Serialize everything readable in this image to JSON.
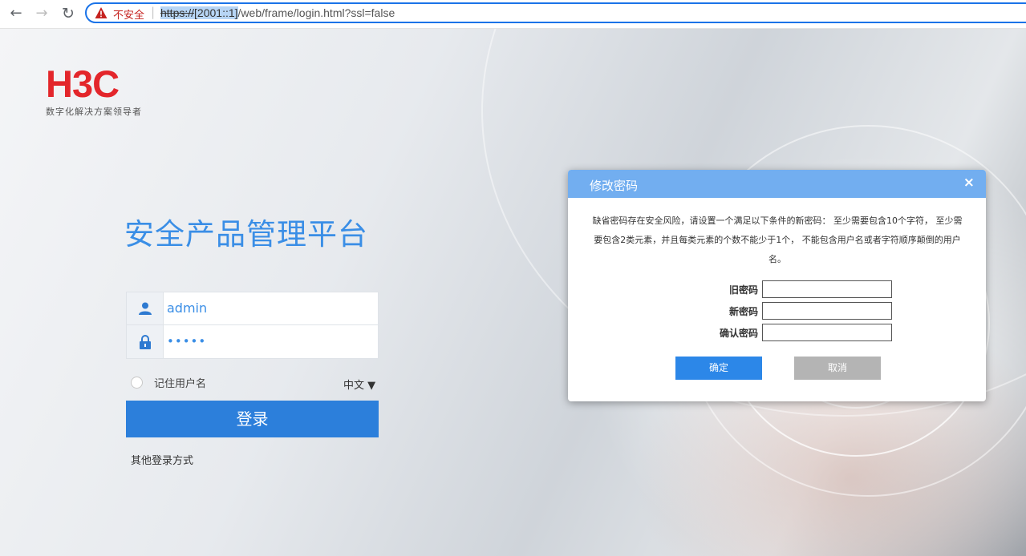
{
  "browser": {
    "security_warning": "不安全",
    "url_protocol": "https://",
    "url_host": "[2001::1]",
    "url_path": "/web/frame/login.html?ssl=false"
  },
  "logo": {
    "brand": "H3C",
    "slogan": "数字化解决方案领导者",
    "color": "#e3262b"
  },
  "login": {
    "title": "安全产品管理平台",
    "username": "admin",
    "password_mask": "•••••",
    "remember_label": "记住用户名",
    "language": "中文 ▼",
    "login_button": "登录",
    "other_login": "其他登录方式",
    "accent_color": "#2c7fdb"
  },
  "dialog": {
    "title": "修改密码",
    "close": "×",
    "message": "缺省密码存在安全风险，请设置一个满足以下条件的新密码： 至少需要包含10个字符， 至少需要包含2类元素，并且每类元素的个数不能少于1个， 不能包含用户名或者字符顺序颠倒的用户名。",
    "old_password_label": "旧密码",
    "new_password_label": "新密码",
    "confirm_password_label": "确认密码",
    "ok_button": "确定",
    "cancel_button": "取消",
    "header_color": "#72aef0"
  }
}
